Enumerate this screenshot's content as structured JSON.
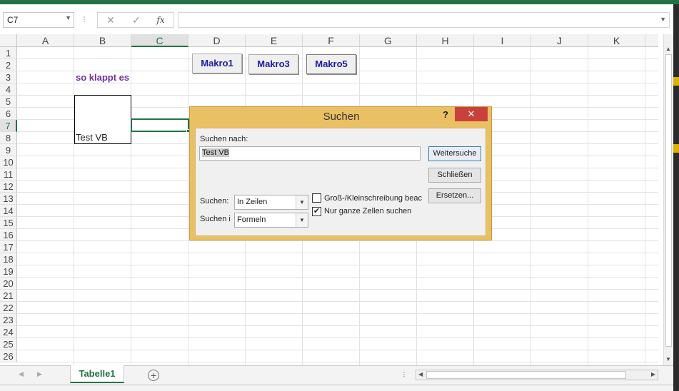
{
  "formula_bar": {
    "name_box": "C7",
    "fx": "fx",
    "formula_value": ""
  },
  "columns": [
    "A",
    "B",
    "C",
    "D",
    "E",
    "F",
    "G",
    "H",
    "I",
    "J",
    "K"
  ],
  "rows": [
    "1",
    "2",
    "3",
    "4",
    "5",
    "6",
    "7",
    "8",
    "9",
    "10",
    "11",
    "12",
    "13",
    "14",
    "15",
    "16",
    "17",
    "18",
    "19",
    "20",
    "21",
    "22",
    "23",
    "24",
    "25",
    "26"
  ],
  "selected_cell": "C7",
  "cells": {
    "b3": "so klappt es",
    "b8": "Test VB"
  },
  "macros": {
    "macro1": "Makro1",
    "macro3": "Makro3",
    "macro5": "Makro5"
  },
  "dialog": {
    "title": "Suchen",
    "help": "?",
    "find_label": "Suchen nach:",
    "find_value": "Test VB",
    "find_next": "Weitersuche",
    "close": "Schließen",
    "replace": "Ersetzen...",
    "search_label": "Suchen:",
    "search_value": "In Zeilen",
    "lookin_label": "Suchen i",
    "lookin_value": "Formeln",
    "match_case_label": "Groß-/Kleinschreibung beac",
    "match_case_checked": false,
    "whole_cells_label": "Nur ganze Zellen suchen",
    "whole_cells_checked": true
  },
  "sheets": {
    "active": "Tabelle1"
  },
  "colors": {
    "excel_green": "#217346",
    "dialog_frame": "#e9c063",
    "close_red": "#c9413b",
    "macro_text": "#1a1aa6",
    "purple_text": "#7030a0"
  }
}
